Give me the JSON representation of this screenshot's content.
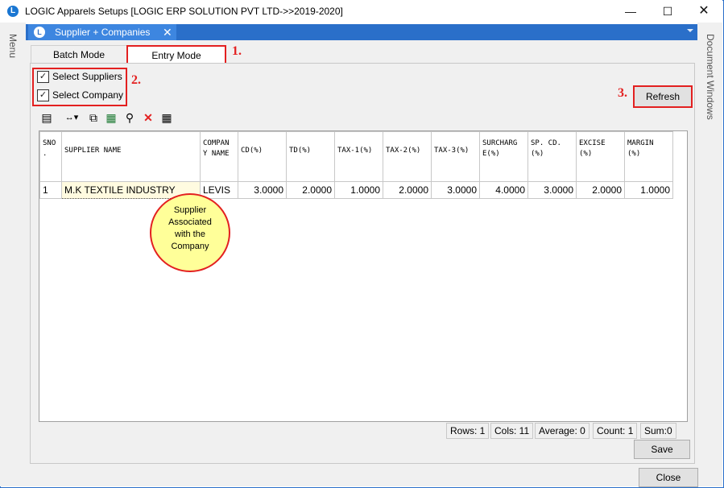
{
  "window": {
    "icon_letter": "L",
    "title": "LOGIC Apparels Setups  [LOGIC ERP SOLUTION PVT LTD->>2019-2020]",
    "minimize": "—",
    "maximize": "☐",
    "close": "✕"
  },
  "rails": {
    "left": "Menu",
    "right": "Document Windows"
  },
  "doc_tab": {
    "icon_letter": "L",
    "label": "Supplier + Companies",
    "close": "✕"
  },
  "mode_tabs": [
    {
      "label": "Batch Mode"
    },
    {
      "label": "Entry Mode"
    }
  ],
  "annotations": {
    "a1": "1.",
    "a2": "2.",
    "a3": "3."
  },
  "checkboxes": [
    {
      "label": "Select Suppliers",
      "checked": "✓"
    },
    {
      "label": "Select Company",
      "checked": "✓"
    }
  ],
  "buttons": {
    "refresh": "Refresh",
    "save": "Save",
    "close": "Close"
  },
  "toolbar": [
    {
      "icon": "form-icon",
      "glyph": "▤"
    },
    {
      "icon": "resize-columns-icon",
      "glyph": "↔▾"
    },
    {
      "icon": "copy-icon",
      "glyph": "⧉"
    },
    {
      "icon": "excel-icon",
      "glyph": "▦"
    },
    {
      "icon": "binoculars-icon",
      "glyph": "⚲"
    },
    {
      "icon": "delete-icon",
      "glyph": "✕"
    },
    {
      "icon": "grid-icon",
      "glyph": "▦"
    }
  ],
  "grid": {
    "headers": [
      "SNO\n.",
      "SUPPLIER NAME",
      "COMPAN\nY NAME",
      "CD(%)",
      "TD(%)",
      "TAX-1(%)",
      "TAX-2(%)",
      "TAX-3(%)",
      "SURCHARG\nE(%)",
      "SP. CD.\n(%)",
      "EXCISE\n(%)",
      "MARGIN\n(%)"
    ],
    "rows": [
      [
        "1",
        "M.K TEXTILE INDUSTRY",
        "LEVIS",
        "3.0000",
        "2.0000",
        "1.0000",
        "2.0000",
        "3.0000",
        "4.0000",
        "3.0000",
        "2.0000",
        "1.0000"
      ]
    ]
  },
  "status": {
    "rows": "Rows: 1",
    "cols": "Cols: 11",
    "average": "Average: 0",
    "count": "Count: 1",
    "sum": "Sum:0"
  },
  "bubble": {
    "line1": "Supplier",
    "line2": "Associated",
    "line3": "with  the",
    "line4": "Company"
  },
  "colors": {
    "accent": "#2a6fc9",
    "annotation": "#e32020",
    "bubble": "#ffff99"
  }
}
